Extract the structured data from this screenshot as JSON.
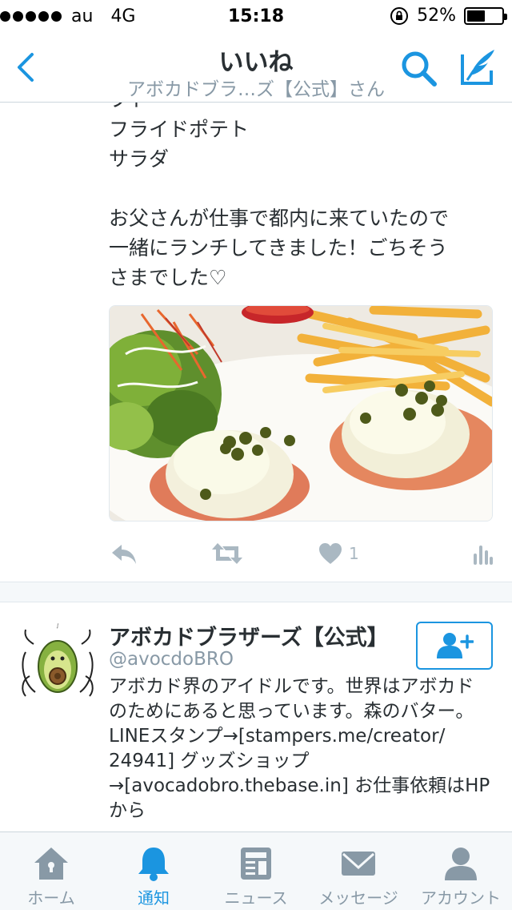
{
  "status_bar": {
    "carrier": "au",
    "network": "4G",
    "time": "15:18",
    "battery_text": "52%",
    "battery_level": 0.52
  },
  "nav": {
    "title": "いいね",
    "subtitle": "アボカドブラ…ズ【公式】さん",
    "back_icon": "chevron-left-icon",
    "search_icon": "search-icon",
    "compose_icon": "compose-icon"
  },
  "tweet": {
    "lines": [
      "フト",
      "フライドポテト",
      "サラダ",
      "",
      "お父さんが仕事で都内に来ていたので",
      "一緒にランチしてきました！ごちそう",
      "さまでした♡"
    ],
    "photo_icon": "food-photo",
    "actions": {
      "reply_icon": "reply-icon",
      "retweet_icon": "retweet-icon",
      "like_icon": "heart-icon",
      "like_count": "1",
      "analytics_icon": "analytics-icon"
    }
  },
  "profile": {
    "name": "アボカドブラザーズ【公式】",
    "handle": "@avocdoBRO",
    "bio_lines": [
      "アボカド界のアイドルです。世界はアボカド",
      "のためにあると思っています。森のバター。",
      "LINEスタンプ→[stampers.me/creator/",
      "24941] グッズショップ",
      "→[avocadobro.thebase.in] お仕事依頼はHP",
      "から"
    ],
    "follow_icon": "add-user-icon"
  },
  "tabs": [
    {
      "label": "ホーム",
      "icon": "home-icon",
      "active": false
    },
    {
      "label": "通知",
      "icon": "bell-icon",
      "active": true
    },
    {
      "label": "ニュース",
      "icon": "news-icon",
      "active": false
    },
    {
      "label": "メッセージ",
      "icon": "envelope-icon",
      "active": false
    },
    {
      "label": "アカウント",
      "icon": "person-icon",
      "active": false
    }
  ],
  "colors": {
    "accent": "#1b95e0",
    "muted": "#8899a6",
    "text": "#292f33"
  }
}
